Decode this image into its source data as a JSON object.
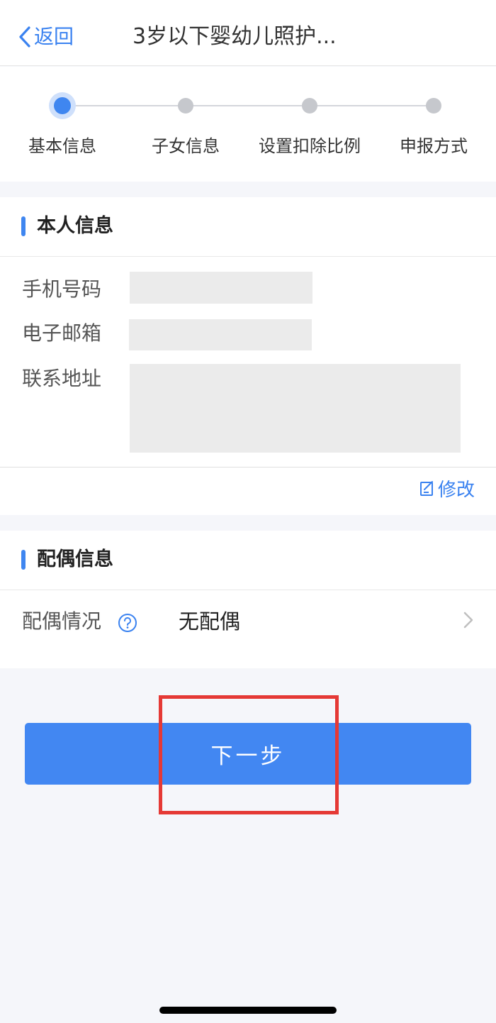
{
  "nav": {
    "back_label": "返回",
    "title": "3岁以下婴幼儿照护..."
  },
  "steps": [
    {
      "label": "基本信息",
      "active": true
    },
    {
      "label": "子女信息",
      "active": false
    },
    {
      "label": "设置扣除比例",
      "active": false
    },
    {
      "label": "申报方式",
      "active": false
    }
  ],
  "personal": {
    "title": "本人信息",
    "phone_label": "手机号码",
    "email_label": "电子邮箱",
    "address_label": "联系地址",
    "edit_label": "修改"
  },
  "spouse": {
    "title": "配偶信息",
    "status_label": "配偶情况",
    "status_value": "无配偶"
  },
  "actions": {
    "next_label": "下一步"
  },
  "colors": {
    "accent": "#4287f2",
    "highlight": "#e53935",
    "background": "#f5f6fa"
  },
  "icons": [
    "chevron-left-icon",
    "edit-icon",
    "help-icon",
    "chevron-right-icon"
  ]
}
